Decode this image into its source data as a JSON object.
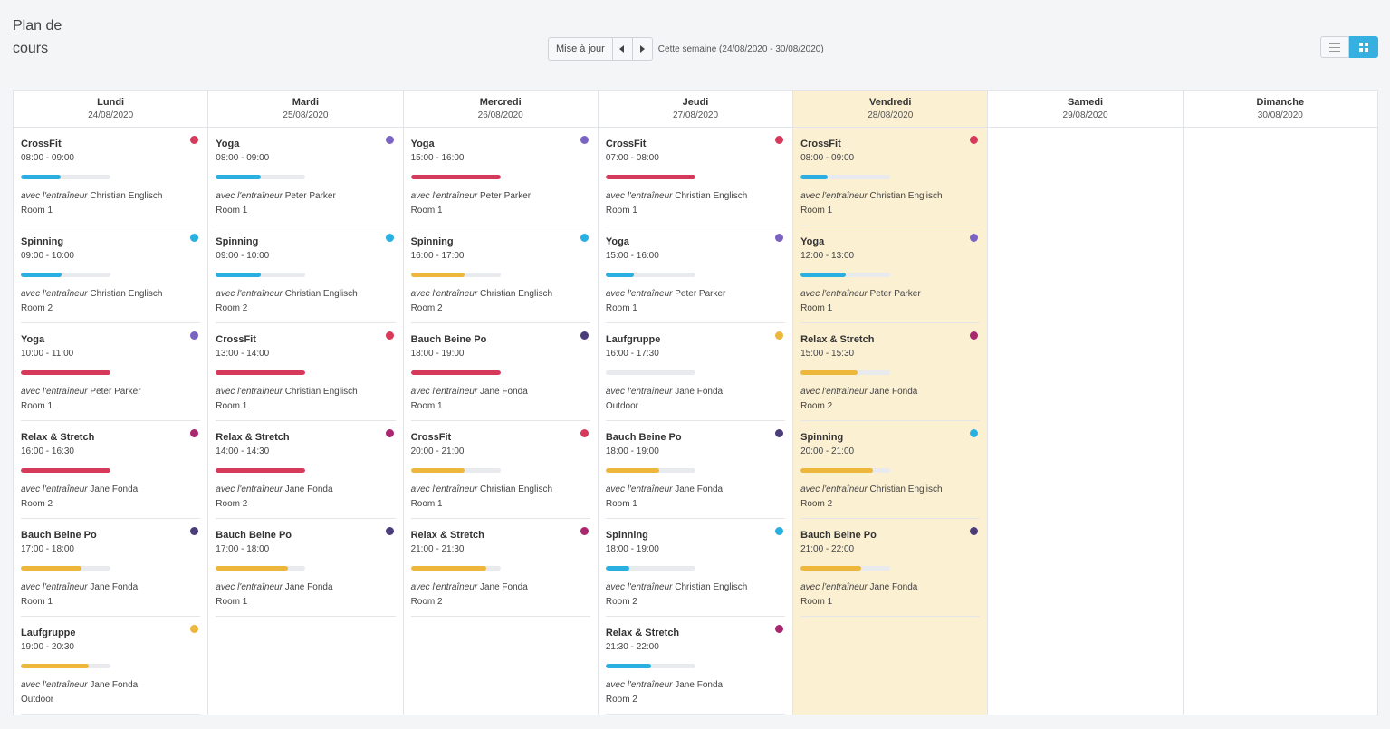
{
  "page": {
    "title": "Plan de cours"
  },
  "toolbar": {
    "today_label": "Mise à jour",
    "prev_icon": "caret-left-icon",
    "next_icon": "caret-right-icon",
    "week_label": "Cette semaine (24/08/2020 - 30/08/2020)"
  },
  "view_toggle": {
    "options": [
      "list-icon",
      "grid-icon"
    ],
    "active": "grid-icon"
  },
  "colors": {
    "crossfit": "#d6395a",
    "spinning": "#2ab0e0",
    "yoga": "#7a63c2",
    "relax": "#a8276f",
    "bauch": "#4a3d7a",
    "laufgruppe": "#ecb73a",
    "bar_red": "#d6395a",
    "bar_blue": "#2ab0e0",
    "bar_yellow": "#ecb73a",
    "today_bg": "#fcf0d2"
  },
  "trainer_prefix": "avec l'entraîneur",
  "days": [
    {
      "name": "Lundi",
      "date": "24/08/2020",
      "today": false,
      "events": [
        {
          "title": "CrossFit",
          "time": "08:00 - 09:00",
          "dot": "#d6395a",
          "fill": 0.44,
          "bar": "#2ab0e0",
          "trainer": "Christian Englisch",
          "room": "Room 1"
        },
        {
          "title": "Spinning",
          "time": "09:00 - 10:00",
          "dot": "#2ab0e0",
          "fill": 0.45,
          "bar": "#2ab0e0",
          "trainer": "Christian Englisch",
          "room": "Room 2"
        },
        {
          "title": "Yoga",
          "time": "10:00 - 11:00",
          "dot": "#7a63c2",
          "fill": 1.0,
          "bar": "#d6395a",
          "trainer": "Peter Parker",
          "room": "Room 1"
        },
        {
          "title": "Relax & Stretch",
          "time": "16:00 - 16:30",
          "dot": "#a8276f",
          "fill": 1.0,
          "bar": "#d6395a",
          "trainer": "Jane Fonda",
          "room": "Room 2"
        },
        {
          "title": "Bauch Beine Po",
          "time": "17:00 - 18:00",
          "dot": "#4a3d7a",
          "fill": 0.68,
          "bar": "#ecb73a",
          "trainer": "Jane Fonda",
          "room": "Room 1"
        },
        {
          "title": "Laufgruppe",
          "time": "19:00 - 20:30",
          "dot": "#ecb73a",
          "fill": 0.76,
          "bar": "#ecb73a",
          "trainer": "Jane Fonda",
          "room": "Outdoor"
        }
      ]
    },
    {
      "name": "Mardi",
      "date": "25/08/2020",
      "today": false,
      "events": [
        {
          "title": "Yoga",
          "time": "08:00 - 09:00",
          "dot": "#7a63c2",
          "fill": 0.5,
          "bar": "#2ab0e0",
          "trainer": "Peter Parker",
          "room": "Room 1"
        },
        {
          "title": "Spinning",
          "time": "09:00 - 10:00",
          "dot": "#2ab0e0",
          "fill": 0.5,
          "bar": "#2ab0e0",
          "trainer": "Christian Englisch",
          "room": "Room 2"
        },
        {
          "title": "CrossFit",
          "time": "13:00 - 14:00",
          "dot": "#d6395a",
          "fill": 1.0,
          "bar": "#d6395a",
          "trainer": "Christian Englisch",
          "room": "Room 1"
        },
        {
          "title": "Relax & Stretch",
          "time": "14:00 - 14:30",
          "dot": "#a8276f",
          "fill": 1.0,
          "bar": "#d6395a",
          "trainer": "Jane Fonda",
          "room": "Room 2"
        },
        {
          "title": "Bauch Beine Po",
          "time": "17:00 - 18:00",
          "dot": "#4a3d7a",
          "fill": 0.81,
          "bar": "#ecb73a",
          "trainer": "Jane Fonda",
          "room": "Room 1"
        }
      ]
    },
    {
      "name": "Mercredi",
      "date": "26/08/2020",
      "today": false,
      "events": [
        {
          "title": "Yoga",
          "time": "15:00 - 16:00",
          "dot": "#7a63c2",
          "fill": 1.0,
          "bar": "#d6395a",
          "trainer": "Peter Parker",
          "room": "Room 1"
        },
        {
          "title": "Spinning",
          "time": "16:00 - 17:00",
          "dot": "#2ab0e0",
          "fill": 0.6,
          "bar": "#ecb73a",
          "trainer": "Christian Englisch",
          "room": "Room 2"
        },
        {
          "title": "Bauch Beine Po",
          "time": "18:00 - 19:00",
          "dot": "#4a3d7a",
          "fill": 1.0,
          "bar": "#d6395a",
          "trainer": "Jane Fonda",
          "room": "Room 1"
        },
        {
          "title": "CrossFit",
          "time": "20:00 - 21:00",
          "dot": "#d6395a",
          "fill": 0.6,
          "bar": "#ecb73a",
          "trainer": "Christian Englisch",
          "room": "Room 1"
        },
        {
          "title": "Relax & Stretch",
          "time": "21:00 - 21:30",
          "dot": "#a8276f",
          "fill": 0.84,
          "bar": "#ecb73a",
          "trainer": "Jane Fonda",
          "room": "Room 2"
        }
      ]
    },
    {
      "name": "Jeudi",
      "date": "27/08/2020",
      "today": false,
      "events": [
        {
          "title": "CrossFit",
          "time": "07:00 - 08:00",
          "dot": "#d6395a",
          "fill": 1.0,
          "bar": "#d6395a",
          "trainer": "Christian Englisch",
          "room": "Room 1"
        },
        {
          "title": "Yoga",
          "time": "15:00 - 16:00",
          "dot": "#7a63c2",
          "fill": 0.31,
          "bar": "#2ab0e0",
          "trainer": "Peter Parker",
          "room": "Room 1"
        },
        {
          "title": "Laufgruppe",
          "time": "16:00 - 17:30",
          "dot": "#ecb73a",
          "fill": 0.0,
          "bar": "#ecb73a",
          "trainer": "Jane Fonda",
          "room": "Outdoor"
        },
        {
          "title": "Bauch Beine Po",
          "time": "18:00 - 19:00",
          "dot": "#4a3d7a",
          "fill": 0.6,
          "bar": "#ecb73a",
          "trainer": "Jane Fonda",
          "room": "Room 1"
        },
        {
          "title": "Spinning",
          "time": "18:00 - 19:00",
          "dot": "#2ab0e0",
          "fill": 0.26,
          "bar": "#2ab0e0",
          "trainer": "Christian Englisch",
          "room": "Room 2"
        },
        {
          "title": "Relax & Stretch",
          "time": "21:30 - 22:00",
          "dot": "#a8276f",
          "fill": 0.51,
          "bar": "#2ab0e0",
          "trainer": "Jane Fonda",
          "room": "Room 2"
        }
      ]
    },
    {
      "name": "Vendredi",
      "date": "28/08/2020",
      "today": true,
      "events": [
        {
          "title": "CrossFit",
          "time": "08:00 - 09:00",
          "dot": "#d6395a",
          "fill": 0.3,
          "bar": "#2ab0e0",
          "trainer": "Christian Englisch",
          "room": "Room 1"
        },
        {
          "title": "Yoga",
          "time": "12:00 - 13:00",
          "dot": "#7a63c2",
          "fill": 0.5,
          "bar": "#2ab0e0",
          "trainer": "Peter Parker",
          "room": "Room 1"
        },
        {
          "title": "Relax & Stretch",
          "time": "15:00 - 15:30",
          "dot": "#a8276f",
          "fill": 0.64,
          "bar": "#ecb73a",
          "trainer": "Jane Fonda",
          "room": "Room 2"
        },
        {
          "title": "Spinning",
          "time": "20:00 - 21:00",
          "dot": "#2ab0e0",
          "fill": 0.81,
          "bar": "#ecb73a",
          "trainer": "Christian Englisch",
          "room": "Room 2"
        },
        {
          "title": "Bauch Beine Po",
          "time": "21:00 - 22:00",
          "dot": "#4a3d7a",
          "fill": 0.68,
          "bar": "#ecb73a",
          "trainer": "Jane Fonda",
          "room": "Room 1"
        }
      ]
    },
    {
      "name": "Samedi",
      "date": "29/08/2020",
      "today": false,
      "events": []
    },
    {
      "name": "Dimanche",
      "date": "30/08/2020",
      "today": false,
      "events": []
    }
  ]
}
